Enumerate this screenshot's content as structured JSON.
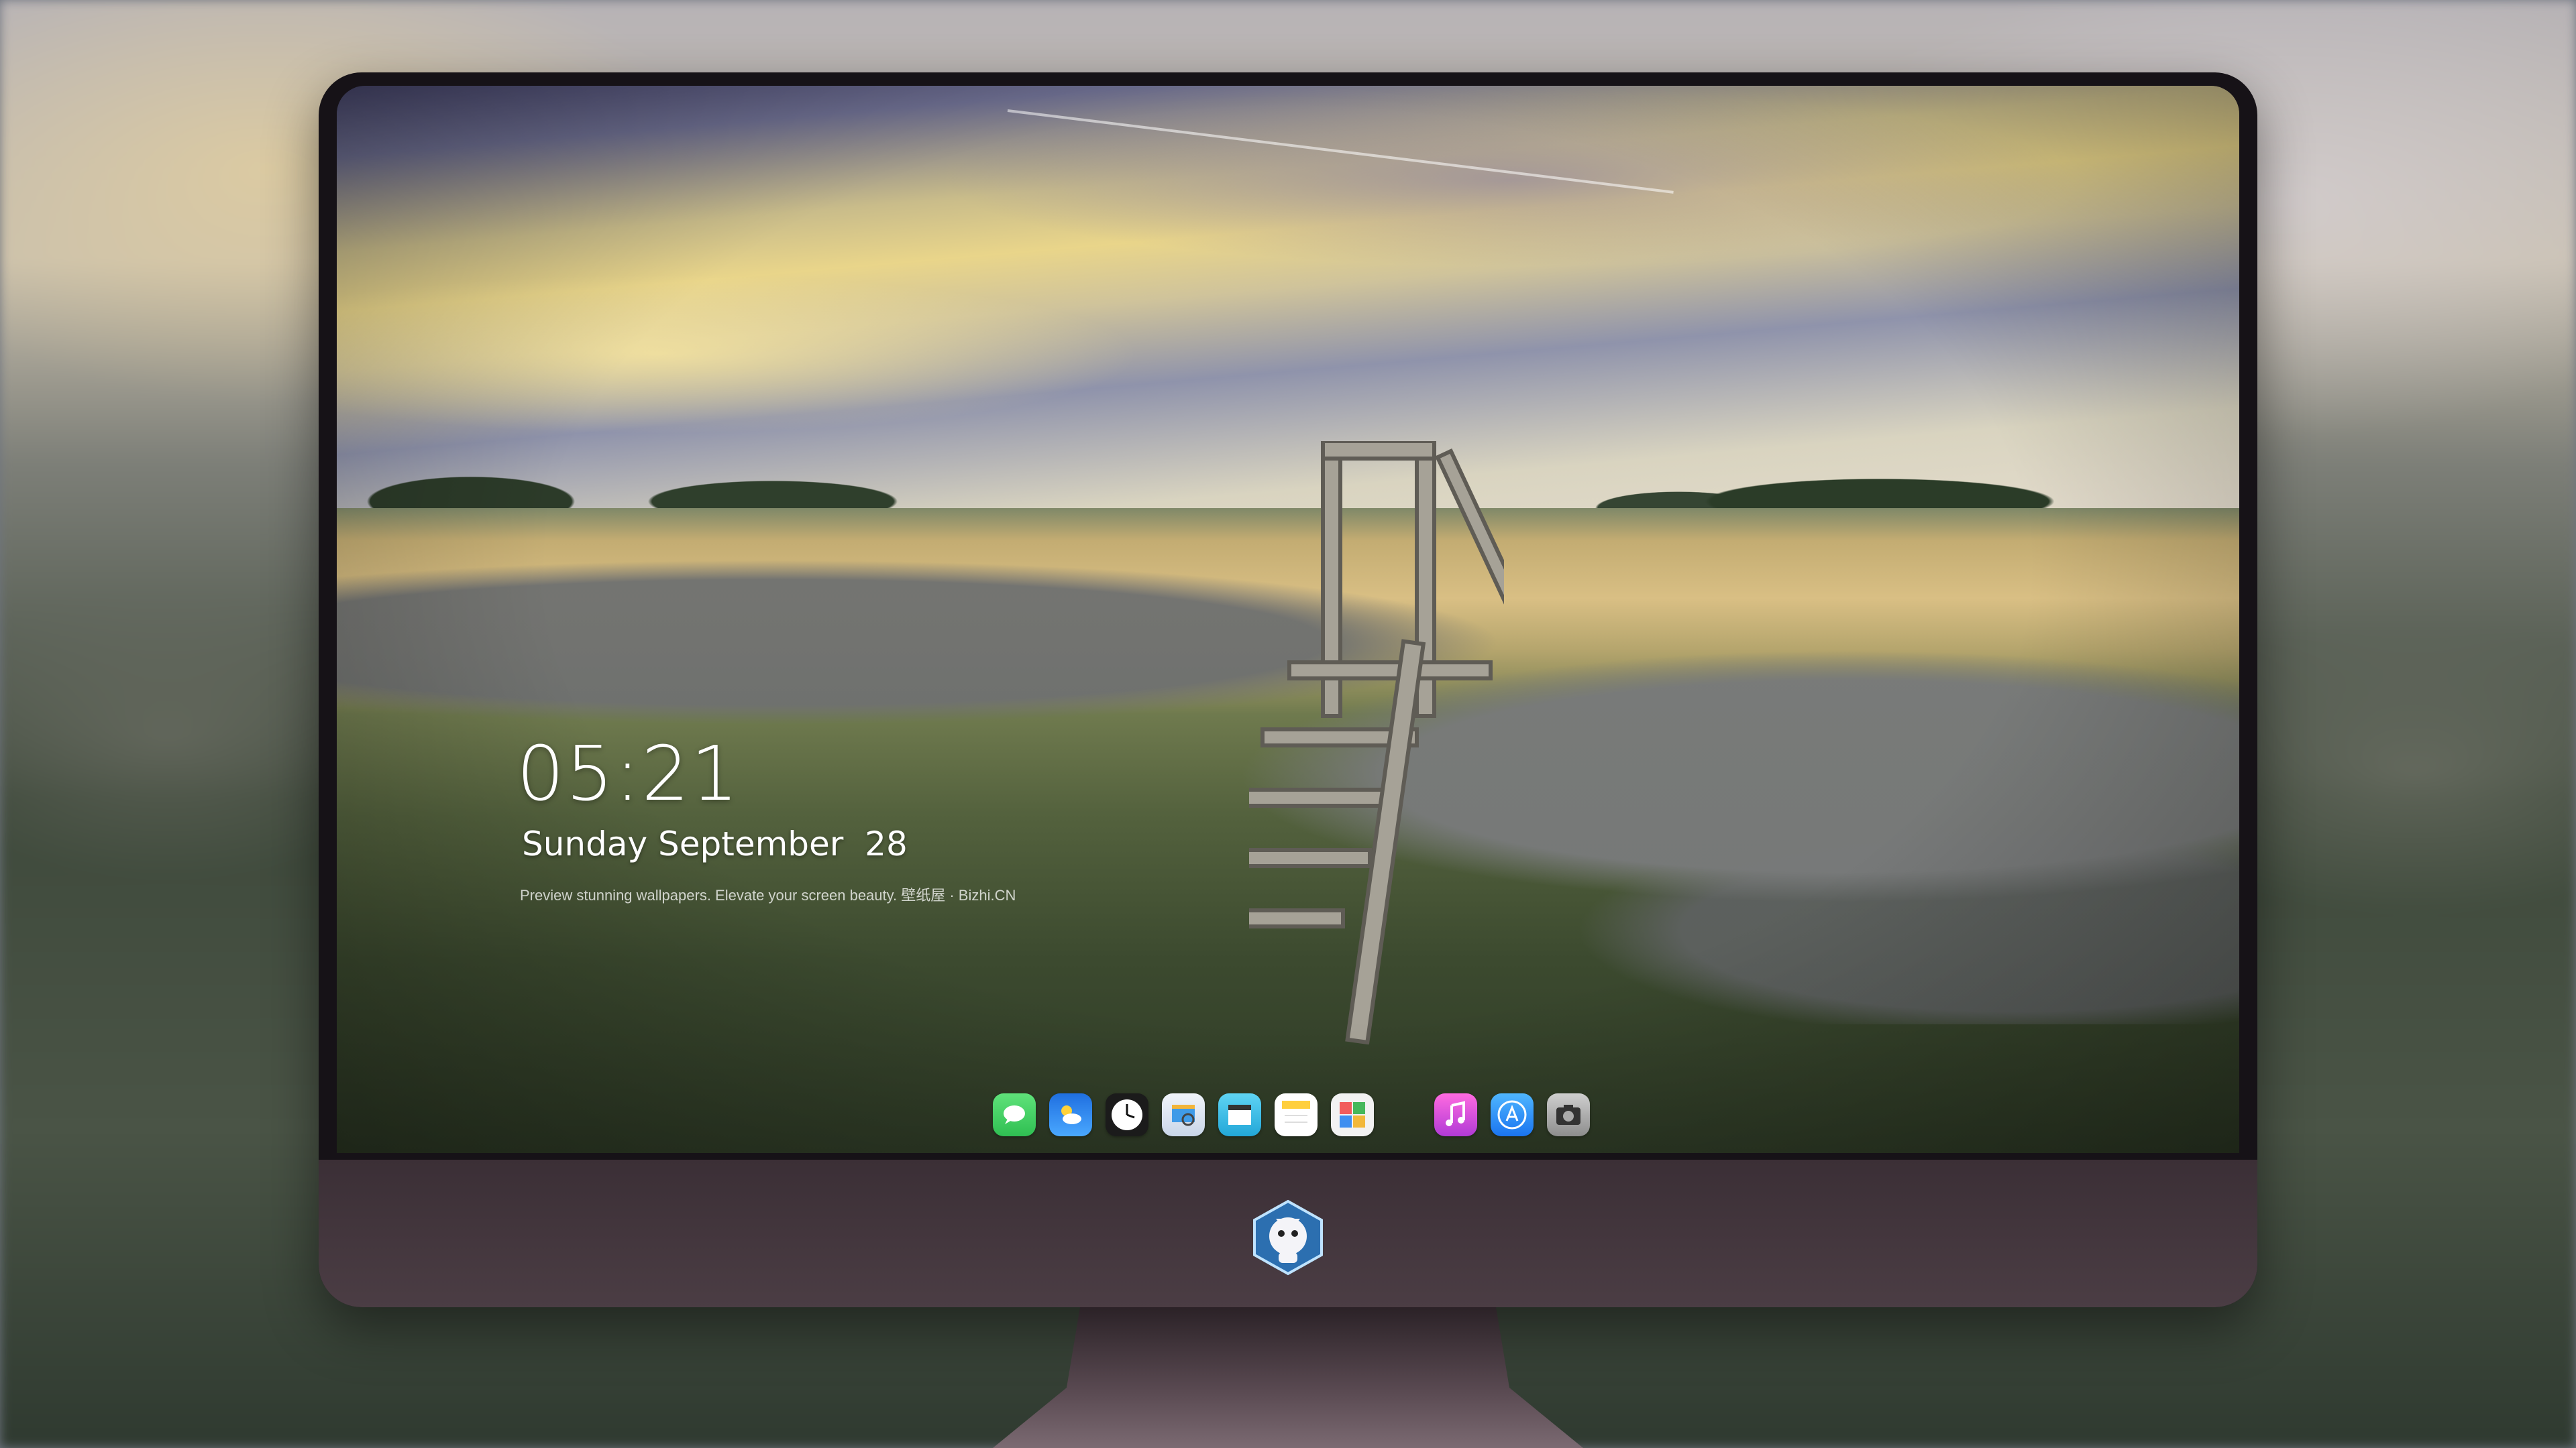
{
  "lockscreen": {
    "time": "05:21",
    "date": "Sunday September  28",
    "tagline": "Preview stunning wallpapers. Elevate your screen beauty. 壁纸屋 · Bizhi.CN"
  },
  "dock": {
    "apps": [
      {
        "name": "messages",
        "icon": "chat-bubble-icon",
        "color": "#34c759"
      },
      {
        "name": "weather",
        "icon": "cloud-sun-icon",
        "color": "#2a8cf0"
      },
      {
        "name": "clock",
        "icon": "clock-icon",
        "color": "#ffffff"
      },
      {
        "name": "preview",
        "icon": "preview-icon",
        "color": "#e8eef6"
      },
      {
        "name": "video",
        "icon": "clapperboard-icon",
        "color": "#3ac0e8"
      },
      {
        "name": "notes",
        "icon": "notes-icon",
        "color": "#ffd54a"
      },
      {
        "name": "photos",
        "icon": "photos-grid-icon",
        "color": "#f2f2f2"
      },
      {
        "name": "music",
        "icon": "music-note-icon",
        "color": "#e84bd0"
      },
      {
        "name": "app-store",
        "icon": "app-store-icon",
        "color": "#1e90ff"
      },
      {
        "name": "camera",
        "icon": "camera-icon",
        "color": "#9a9a9a"
      }
    ]
  },
  "colors": {
    "bezel": "#161217",
    "chin": "#4b3d44",
    "text": "#ffffff"
  }
}
